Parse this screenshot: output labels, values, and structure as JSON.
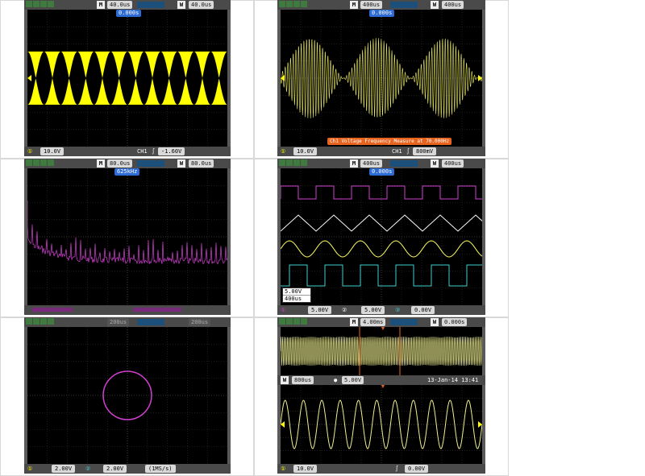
{
  "panels": [
    {
      "top_timebase": "40.0us",
      "window_timebase": "40.0us",
      "trigger_pos": "0.000s",
      "ch_scale": "10.0V",
      "trig_source": "CH1",
      "trig_level": "-1.60V",
      "wave_color": "#ffff00"
    },
    {
      "top_timebase": "400us",
      "window_timebase": "400us",
      "trigger_pos": "0.000s",
      "ch_scale": "10.0V",
      "trig_source": "CH1",
      "trig_level": "800mV",
      "status_banner": "Ch1 Voltage Frequency Measure at 70.000Hz",
      "wave_color": "#e8e860"
    },
    {
      "top_timebase": "80.0us",
      "window_timebase": "80.0us",
      "trigger_pos": "625kHz",
      "wave_color": "#d040d0"
    },
    {
      "top_timebase": "400us",
      "window_timebase": "400us",
      "trigger_pos": "0.000s",
      "popup_volts": "5.00V",
      "popup_time": "400us",
      "ch1_scale": "5.00V",
      "ch2_scale": "5.00V",
      "trig_scale": "0.00V",
      "colors": [
        "#d040d0",
        "#ffffff",
        "#ffff60",
        "#40d0d0"
      ]
    },
    {
      "top_timebase": "200us",
      "window_timebase": "200us",
      "ch1_scale": "2.00V",
      "ch2_scale": "2.00V",
      "sample_rate": "(1MS/s)",
      "wave_color": "#d040d0"
    },
    {
      "top_timebase": "4.00ms",
      "window_timebase": "0.000s",
      "trigger_pos": "0.000s",
      "zoom_timebase": "800us",
      "zoom_pos": "5.00V",
      "datetime": "13-Jan-14 13:41",
      "ch_scale": "10.0V",
      "trig_level": "0.00V",
      "wave_color": "#f0f090"
    }
  ]
}
